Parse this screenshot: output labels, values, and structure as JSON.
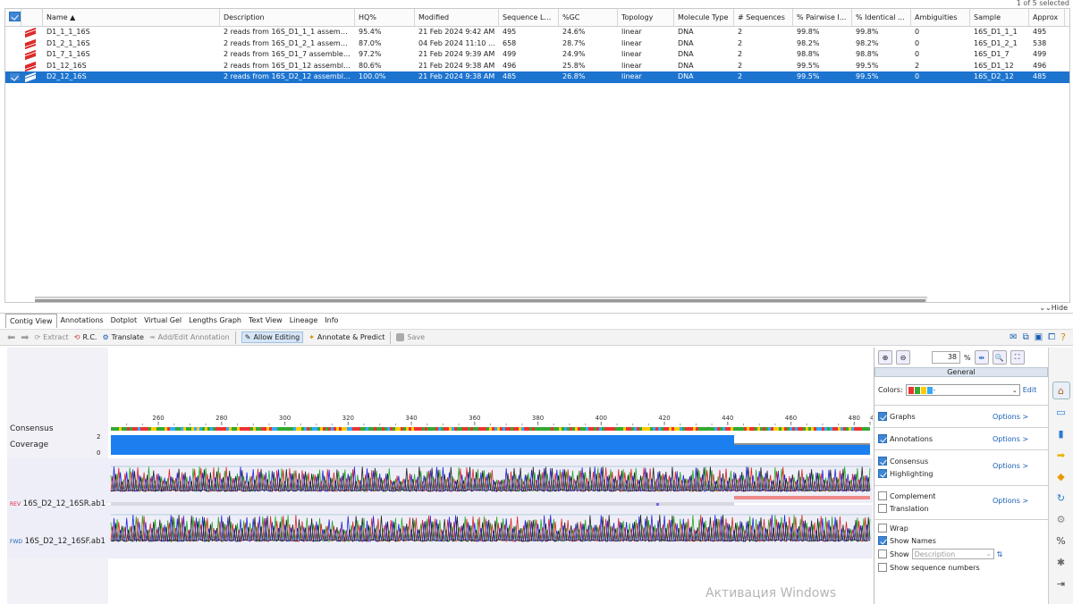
{
  "selection_count": "1 of 5 selected",
  "columns": [
    "Name ▲",
    "Description",
    "HQ%",
    "Modified",
    "Sequence Le...",
    "%GC",
    "Topology",
    "Molecule Type",
    "# Sequences",
    "% Pairwise I...",
    "% Identical ...",
    "Ambiguities",
    "Sample",
    "Approx"
  ],
  "rows": [
    {
      "name": "D1_1_1_16S",
      "desc": "2 reads from 16S_D1_1_1 assembled ...",
      "hq": "95.4%",
      "modified": "21 Feb 2024 9:42 AM",
      "len": "495",
      "gc": "24.6%",
      "topology": "linear",
      "mol": "DNA",
      "nseq": "2",
      "pairwise": "99.8%",
      "identical": "99.8%",
      "amb": "0",
      "sample": "16S_D1_1_1",
      "approx": "495",
      "selected": false
    },
    {
      "name": "D1_2_1_16S",
      "desc": "2 reads from 16S_D1_2_1 assembled ...",
      "hq": "87.0%",
      "modified": "04 Feb 2024 11:10 PM",
      "len": "658",
      "gc": "28.7%",
      "topology": "linear",
      "mol": "DNA",
      "nseq": "2",
      "pairwise": "98.2%",
      "identical": "98.2%",
      "amb": "0",
      "sample": "16S_D1_2_1",
      "approx": "538",
      "selected": false
    },
    {
      "name": "D1_7_1_16S",
      "desc": "2 reads from 16S_D1_7 assembled usi...",
      "hq": "97.2%",
      "modified": "21 Feb 2024 9:39 AM",
      "len": "499",
      "gc": "24.9%",
      "topology": "linear",
      "mol": "DNA",
      "nseq": "2",
      "pairwise": "98.8%",
      "identical": "98.8%",
      "amb": "0",
      "sample": "16S_D1_7",
      "approx": "499",
      "selected": false
    },
    {
      "name": "D1_12_16S",
      "desc": "2 reads from 16S_D1_12 assembled u...",
      "hq": "80.6%",
      "modified": "21 Feb 2024 9:38 AM",
      "len": "496",
      "gc": "25.8%",
      "topology": "linear",
      "mol": "DNA",
      "nseq": "2",
      "pairwise": "99.5%",
      "identical": "99.5%",
      "amb": "2",
      "sample": "16S_D1_12",
      "approx": "496",
      "selected": false
    },
    {
      "name": "D2_12_16S",
      "desc": "2 reads from 16S_D2_12 assembled u...",
      "hq": "100.0%",
      "modified": "21 Feb 2024 9:38 AM",
      "len": "485",
      "gc": "26.8%",
      "topology": "linear",
      "mol": "DNA",
      "nseq": "2",
      "pairwise": "99.5%",
      "identical": "99.5%",
      "amb": "0",
      "sample": "16S_D2_12",
      "approx": "485",
      "selected": true
    }
  ],
  "hide_label": "Hide",
  "tabs": [
    "Contig View",
    "Annotations",
    "Dotplot",
    "Virtual Gel",
    "Lengths Graph",
    "Text View",
    "Lineage",
    "Info"
  ],
  "toolbar": {
    "extract": "Extract",
    "rc": "R.C.",
    "translate": "Translate",
    "add_annotation": "Add/Edit Annotation",
    "allow_editing": "Allow Editing",
    "annotate_predict": "Annotate & Predict",
    "save": "Save"
  },
  "viewer": {
    "ruler_ticks": [
      "260",
      "280",
      "300",
      "320",
      "340",
      "360",
      "380",
      "400",
      "420",
      "440",
      "460",
      "480",
      "485"
    ],
    "consensus_label": "Consensus",
    "coverage_label": "Coverage",
    "coverage_max": "2",
    "coverage_min": "0",
    "read1": {
      "dir": "REV",
      "name": "16S_D2_12_16SR.ab1"
    },
    "read2": {
      "dir": "FWD",
      "name": "16S_D2_12_16SF.ab1"
    }
  },
  "panel": {
    "zoom": "38",
    "zoom_unit": "%",
    "header": "General",
    "colors_label": "Colors:",
    "edit_label": "Edit",
    "graphs": "Graphs",
    "annotations": "Annotations",
    "consensus": "Consensus",
    "highlighting": "Highlighting",
    "complement": "Complement",
    "translation": "Translation",
    "wrap": "Wrap",
    "show_names": "Show Names",
    "show": "Show",
    "show_placeholder": "Description",
    "show_seq_numbers": "Show sequence numbers",
    "options": "Options >"
  },
  "watermark": "Активация Windows"
}
